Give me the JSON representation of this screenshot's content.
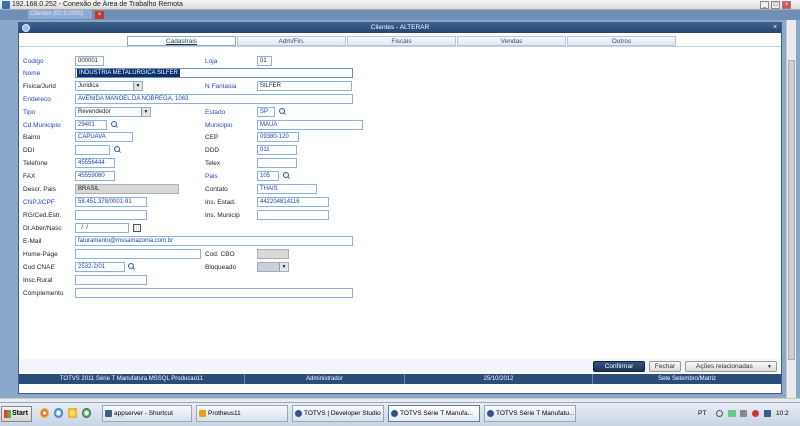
{
  "rdp": {
    "title": "192.168.0.252 - Conexão de Área de Trabalho Remota",
    "client_tab": "Clientes [02.9.0005]"
  },
  "dialog": {
    "title": "Clientes - ALTERAR",
    "tabs": [
      {
        "label": "Cadastrais",
        "active": true
      },
      {
        "label": "Adm/Fin.",
        "active": false
      },
      {
        "label": "Fiscais",
        "active": false
      },
      {
        "label": "Vendas",
        "active": false
      },
      {
        "label": "Outros",
        "active": false
      }
    ]
  },
  "form": {
    "codigo": {
      "label": "Codigo",
      "value": "000001"
    },
    "loja": {
      "label": "Loja",
      "value": "01"
    },
    "nome": {
      "label": "Nome",
      "value": "INDUSTRIA METALURGICA SILFER"
    },
    "fisica_jurid": {
      "label": "Fisica/Jurid",
      "value": "Juridica"
    },
    "n_fantasia": {
      "label": "N Fantasia",
      "value": "SILFER"
    },
    "endereco": {
      "label": "Endereco",
      "value": "AVENIDA MANOEL DA NOBREGA, 1063"
    },
    "tipo": {
      "label": "Tipo",
      "value": "Revendedor"
    },
    "estado": {
      "label": "Estado",
      "value": "SP"
    },
    "cd_municipio": {
      "label": "Cd.Municipio",
      "value": "29401"
    },
    "municipio": {
      "label": "Municipio",
      "value": "MAUA"
    },
    "bairro": {
      "label": "Bairro",
      "value": "CAPUAVA"
    },
    "cep": {
      "label": "CEP",
      "value": "09380-120"
    },
    "ddi": {
      "label": "DDI",
      "value": ""
    },
    "ddd": {
      "label": "DDD",
      "value": "011"
    },
    "telefone": {
      "label": "Telefone",
      "value": "45556444"
    },
    "telex": {
      "label": "Telex",
      "value": ""
    },
    "fax": {
      "label": "FAX",
      "value": "45559080"
    },
    "pais": {
      "label": "Pais",
      "value": "105"
    },
    "descr_pais": {
      "label": "Descr. Pais",
      "value": "BRASIL"
    },
    "contato": {
      "label": "Contato",
      "value": "THAIS"
    },
    "cnpj_cpf": {
      "label": "CNPJ/CPF",
      "value": "58.451.378/0001-91"
    },
    "ins_estad": {
      "label": "Ins. Estad.",
      "value": "442204814116"
    },
    "rg_ced_estr": {
      "label": "RG/Ced.Estr.",
      "value": ""
    },
    "ins_municip": {
      "label": "Ins. Municip",
      "value": ""
    },
    "dt_aber_nasc": {
      "label": "Dt.Aber/Nasc",
      "value": "  /  /  "
    },
    "email": {
      "label": "E-Mail",
      "value": "faturamento@mssamazonia.com.br"
    },
    "home_page": {
      "label": "Home-Page",
      "value": ""
    },
    "cod_cbo": {
      "label": "Cod. CBO",
      "value": ""
    },
    "cod_cnae": {
      "label": "Cod CNAE",
      "value": "2532-2/01"
    },
    "bloqueado": {
      "label": "Bloqueado",
      "value": ""
    },
    "insc_rural": {
      "label": "Insc.Rural",
      "value": ""
    },
    "complemento": {
      "label": "Complemento",
      "value": ""
    }
  },
  "buttons": {
    "confirmar": "Confirmar",
    "fechar": "Fechar",
    "acoes": "Ações relacionadas"
  },
  "status": {
    "app": "TOTVS 2011 Série T Manufatura MSSQL Producao11",
    "user": "Administrador",
    "date": "25/10/2012",
    "company": "Sete Setembro/Matriz"
  },
  "taskbar": {
    "start": "Start",
    "tasks": [
      {
        "label": "appserver - Shortcut"
      },
      {
        "label": "Protheus11"
      },
      {
        "label": "TOTVS | Developer Studio"
      },
      {
        "label": "TOTVS Série T Manufa..."
      },
      {
        "label": "TOTVS Série T Manufatu..."
      }
    ],
    "lang": "PT",
    "clock": "10:2"
  }
}
